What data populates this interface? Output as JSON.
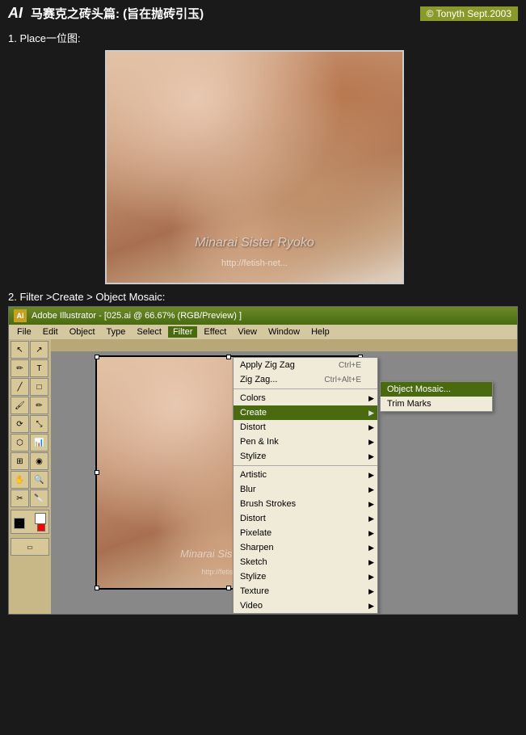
{
  "header": {
    "ai_label": "AI",
    "title": "马赛克之砖头篇: (旨在抛砖引玉)",
    "copyright": "© Tonyth",
    "date": "Sept.2003"
  },
  "step1": {
    "label": "1. Place一位图:"
  },
  "photo": {
    "watermark": "Minarai Sister Ryoko",
    "url": "http://fetish-net..."
  },
  "step2": {
    "label": "2. Filter >Create > Object  Mosaic:"
  },
  "ai_window": {
    "titlebar": "Adobe Illustrator - [025.ai @ 66.67% (RGB/Preview) ]",
    "menubar": {
      "items": [
        "File",
        "Edit",
        "Object",
        "Type",
        "Select",
        "Filter",
        "Effect",
        "View",
        "Window",
        "Help"
      ]
    }
  },
  "filter_menu": {
    "items": [
      {
        "label": "Apply Zig Zag",
        "shortcut": "Ctrl+E",
        "has_sub": false
      },
      {
        "label": "Zig Zag...",
        "shortcut": "Ctrl+Alt+E",
        "has_sub": false
      },
      {
        "label": "separator1"
      },
      {
        "label": "Colors",
        "has_sub": true,
        "highlighted": false
      },
      {
        "label": "Create",
        "has_sub": true,
        "highlighted": true
      },
      {
        "label": "Distort",
        "has_sub": true
      },
      {
        "label": "Pen & Ink",
        "has_sub": true
      },
      {
        "label": "Stylize",
        "has_sub": true
      },
      {
        "label": "separator2"
      },
      {
        "label": "Artistic",
        "has_sub": true
      },
      {
        "label": "Blur",
        "has_sub": true
      },
      {
        "label": "Brush Strokes",
        "has_sub": true
      },
      {
        "label": "Distort",
        "has_sub": true
      },
      {
        "label": "Pixelate",
        "has_sub": true
      },
      {
        "label": "Sharpen",
        "has_sub": true
      },
      {
        "label": "Sketch",
        "has_sub": true
      },
      {
        "label": "Stylize",
        "has_sub": true
      },
      {
        "label": "Texture",
        "has_sub": true
      },
      {
        "label": "Video",
        "has_sub": true
      }
    ]
  },
  "submenu_create": {
    "items": [
      {
        "label": "Object Mosaic...",
        "highlighted": true
      },
      {
        "label": "Trim Marks"
      }
    ]
  },
  "toolbar": {
    "tools": [
      "↖",
      "◌",
      "✏",
      "T",
      "╱",
      "□",
      "○",
      "✂",
      "⬡",
      "⊕",
      "⬛",
      "⟳"
    ]
  }
}
